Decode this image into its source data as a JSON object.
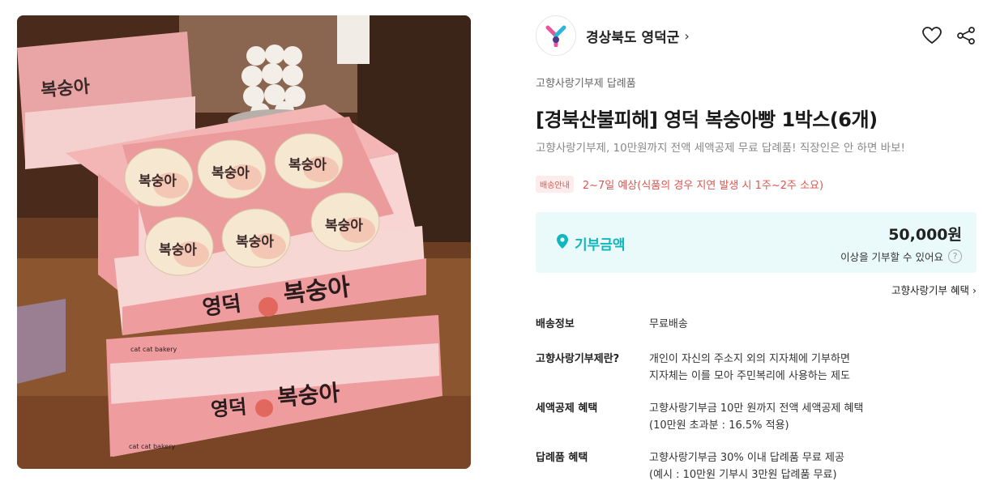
{
  "seller": {
    "name": "경상북도 영덕군",
    "chevron": "›",
    "logo_icon": "yeongdeok-logo-icon",
    "actions": {
      "wish_icon": "heart-icon",
      "share_icon": "share-icon"
    }
  },
  "product": {
    "image_icon": "product-photo-peach-bread-boxes",
    "photo_text": {
      "box_brand_1": "영덕",
      "box_brand_2": "복숭아",
      "box_side_small": "cat cat bakery",
      "pastry_label": "복숭아"
    },
    "category": "고향사랑기부제 답례품",
    "title": "[경북산불피해] 영덕 복숭아빵 1박스(6개)",
    "subtitle": "고향사랑기부제, 10만원까지 전액 세액공제 무료 답례품! 직장인은 안 하면 바보!"
  },
  "shipping": {
    "badge": "배송안내",
    "text": "2~7일 예상(식품의 경우 지연 발생 시 1주~2주 소요)"
  },
  "donation": {
    "label": "기부금액",
    "amount": "50,000원",
    "sub": "이상을 기부할 수 있어요",
    "help": "?",
    "accent_color": "#10b8bd",
    "bg_color": "#eafafb"
  },
  "benefit_link": "고향사랑기부 혜택 ›",
  "info": {
    "rows": [
      {
        "key": "배송정보",
        "lines": [
          "무료배송"
        ]
      },
      {
        "key": "고향사랑기부제란?",
        "lines": [
          "개인이 자신의 주소지 외의 지자체에 기부하면",
          "지자체는 이를 모아 주민복리에 사용하는 제도"
        ]
      },
      {
        "key": "세액공제 혜택",
        "lines": [
          "고향사랑기부금 10만 원까지 전액 세액공제 혜택",
          "(10만원 초과분 : 16.5% 적용)"
        ]
      },
      {
        "key": "답례품 혜택",
        "lines": [
          "고향사랑기부금 30% 이내 답례품 무료 제공",
          "(예시 : 10만원 기부시 3만원 답례품 무료)"
        ]
      }
    ]
  }
}
